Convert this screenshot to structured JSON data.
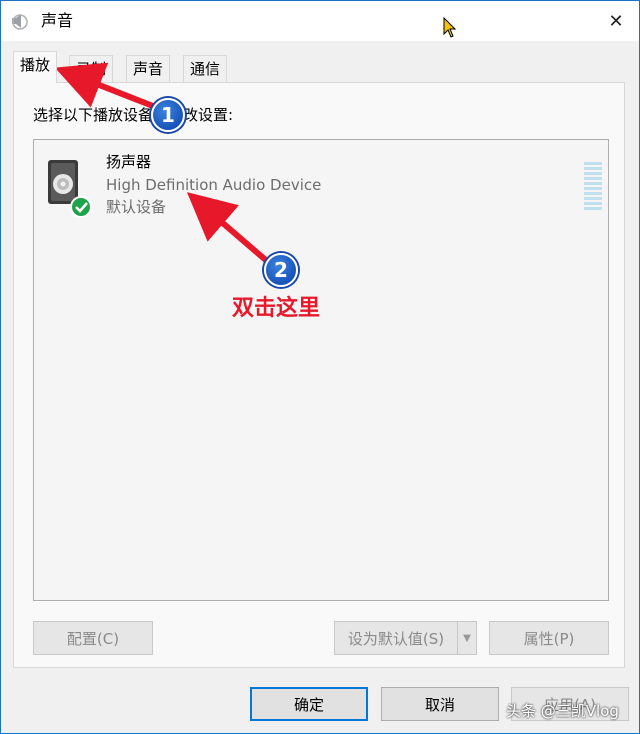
{
  "window": {
    "title": "声音",
    "close_glyph": "✕"
  },
  "tabs": [
    {
      "label": "播放",
      "active": true
    },
    {
      "label": "录制",
      "active": false
    },
    {
      "label": "声音",
      "active": false
    },
    {
      "label": "通信",
      "active": false
    }
  ],
  "instruction": "选择以下播放设备来修改设置:",
  "device": {
    "name": "扬声器",
    "description": "High Definition Audio Device",
    "status": "默认设备",
    "icon": "speaker-icon",
    "default_badge": "check-icon"
  },
  "buttons": {
    "configure": "配置(C)",
    "set_default": "设为默认值(S)",
    "properties": "属性(P)",
    "ok": "确定",
    "cancel": "取消",
    "apply": "应用(A)"
  },
  "annotations": {
    "badge1": "1",
    "badge2": "2",
    "hint": "双击这里",
    "color": "#e8182b"
  },
  "watermark": "头条 @三凯Vlog"
}
